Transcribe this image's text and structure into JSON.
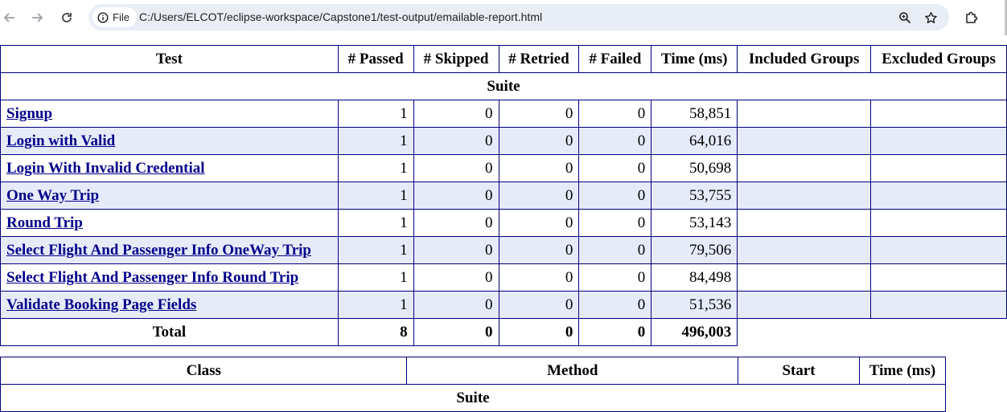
{
  "browser": {
    "site_chip": "File",
    "url": "C:/Users/ELCOT/eclipse-workspace/Capstone1/test-output/emailable-report.html"
  },
  "summary": {
    "headers": [
      "Test",
      "# Passed",
      "# Skipped",
      "# Retried",
      "# Failed",
      "Time (ms)",
      "Included Groups",
      "Excluded Groups"
    ],
    "suite_label": "Suite",
    "rows": [
      {
        "test": "Signup",
        "passed": "1",
        "skipped": "0",
        "retried": "0",
        "failed": "0",
        "time": "58,851"
      },
      {
        "test": "Login with Valid",
        "passed": "1",
        "skipped": "0",
        "retried": "0",
        "failed": "0",
        "time": "64,016"
      },
      {
        "test": "Login With Invalid Credential",
        "passed": "1",
        "skipped": "0",
        "retried": "0",
        "failed": "0",
        "time": "50,698"
      },
      {
        "test": "One Way Trip",
        "passed": "1",
        "skipped": "0",
        "retried": "0",
        "failed": "0",
        "time": "53,755"
      },
      {
        "test": "Round Trip",
        "passed": "1",
        "skipped": "0",
        "retried": "0",
        "failed": "0",
        "time": "53,143"
      },
      {
        "test": "Select Flight And Passenger Info OneWay Trip",
        "passed": "1",
        "skipped": "0",
        "retried": "0",
        "failed": "0",
        "time": "79,506"
      },
      {
        "test": "Select Flight And Passenger Info Round Trip",
        "passed": "1",
        "skipped": "0",
        "retried": "0",
        "failed": "0",
        "time": "84,498"
      },
      {
        "test": "Validate Booking Page Fields",
        "passed": "1",
        "skipped": "0",
        "retried": "0",
        "failed": "0",
        "time": "51,536"
      }
    ],
    "total": {
      "label": "Total",
      "passed": "8",
      "skipped": "0",
      "retried": "0",
      "failed": "0",
      "time": "496,003"
    }
  },
  "methods": {
    "headers": [
      "Class",
      "Method",
      "Start",
      "Time (ms)"
    ],
    "suite_label": "Suite"
  },
  "colors": {
    "border": "#000080",
    "link": "#00008b",
    "alt_row": "#e6ebf9",
    "omnibox": "#e9eef6"
  }
}
